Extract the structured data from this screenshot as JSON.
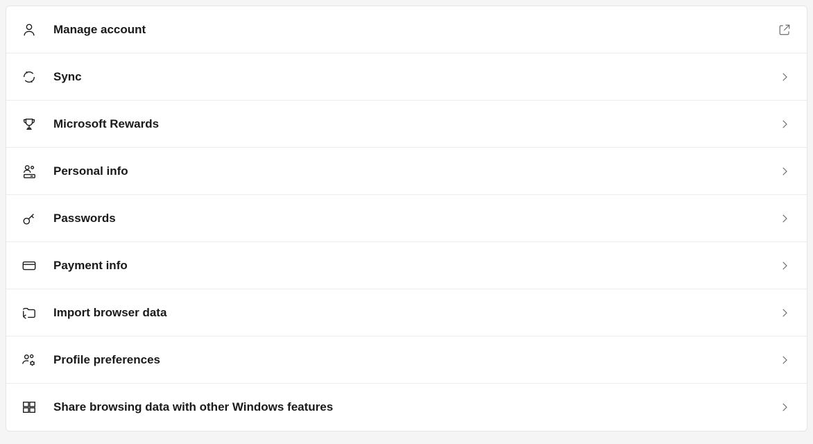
{
  "settings": {
    "items": [
      {
        "id": "manage-account",
        "label": "Manage account",
        "icon": "person-icon",
        "action": "external"
      },
      {
        "id": "sync",
        "label": "Sync",
        "icon": "sync-icon",
        "action": "chevron"
      },
      {
        "id": "microsoft-rewards",
        "label": "Microsoft Rewards",
        "icon": "trophy-icon",
        "action": "chevron"
      },
      {
        "id": "personal-info",
        "label": "Personal info",
        "icon": "person-card-icon",
        "action": "chevron"
      },
      {
        "id": "passwords",
        "label": "Passwords",
        "icon": "key-icon",
        "action": "chevron"
      },
      {
        "id": "payment-info",
        "label": "Payment info",
        "icon": "credit-card-icon",
        "action": "chevron"
      },
      {
        "id": "import-browser-data",
        "label": "Import browser data",
        "icon": "import-icon",
        "action": "chevron"
      },
      {
        "id": "profile-preferences",
        "label": "Profile preferences",
        "icon": "people-settings-icon",
        "action": "chevron"
      },
      {
        "id": "share-browsing-data",
        "label": "Share browsing data with other Windows features",
        "icon": "windows-icon",
        "action": "chevron"
      }
    ]
  }
}
